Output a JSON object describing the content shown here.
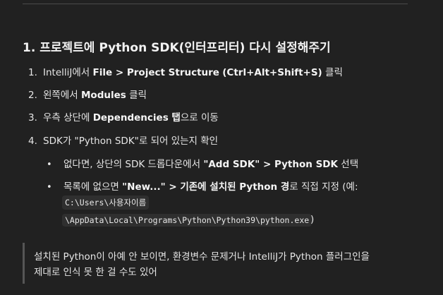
{
  "heading": "1. 프로젝트에 Python SDK(인터프리터) 다시 설정해주기",
  "steps": [
    {
      "num": "1.",
      "pre": "IntelliJ에서 ",
      "b1": "File",
      "mid": " > ",
      "b2": "Project Structure",
      "post": " ",
      "b3": "(Ctrl+Alt+Shift+S)",
      "tail": " 클릭"
    },
    {
      "num": "2.",
      "pre": "왼쪽에서 ",
      "b1": "Modules",
      "tail": " 클릭"
    },
    {
      "num": "3.",
      "pre": "우측 상단에 ",
      "b1": "Dependencies",
      "b2": " 탭",
      "tail": "으로 이동"
    },
    {
      "num": "4.",
      "text": "SDK가 \"Python SDK\"로 되어 있는지 확인"
    }
  ],
  "subitems": [
    {
      "pre": "없다면, 상단의 SDK 드롭다운에서 ",
      "b1": "\"Add SDK\"",
      "mid": " > ",
      "b2": "Python SDK",
      "tail": " 선택"
    },
    {
      "pre": "목록에 없으면 ",
      "b1": "\"New...\"",
      "mid": " > ",
      "b2": "기존에 설치된 Python 경",
      "tail": "로 직접 지정 (예:"
    }
  ],
  "code_line1": "C:\\Users\\사용자이름",
  "code_line2": "\\AppData\\Local\\Programs\\Python\\Python39\\python.exe",
  "code_after": ")",
  "note_line1": "설치된 Python이 아예 안 보이면, 환경변수 문제거나 IntelliJ가 Python 플러그인을",
  "note_line2": "제대로 인식 못 한 걸 수도 있어"
}
